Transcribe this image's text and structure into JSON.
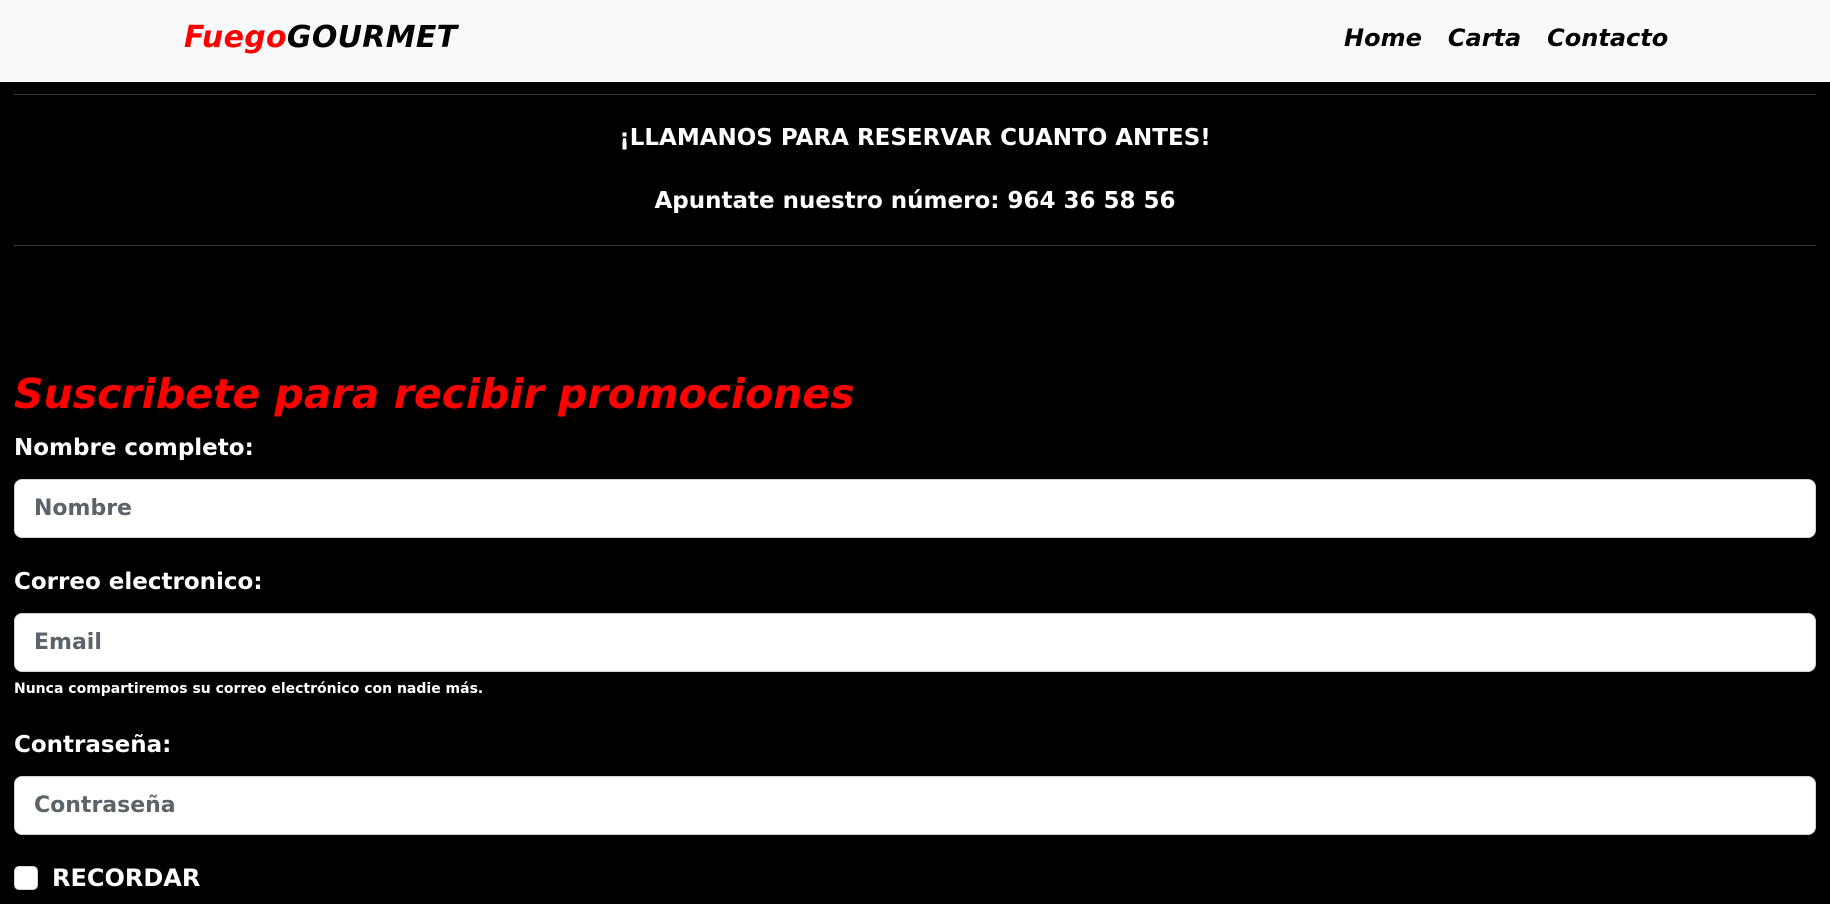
{
  "navbar": {
    "brand_part1": "Fuego",
    "brand_part2": "GOURMET",
    "links": [
      "Home",
      "Carta",
      "Contacto"
    ]
  },
  "promo": {
    "line1": "¡LLAMANOS PARA RESERVAR CUANTO ANTES!",
    "line2": "Apuntate nuestro número: 964 36 58 56"
  },
  "form": {
    "title": "Suscribete para recibir promociones",
    "name_label": "Nombre completo:",
    "name_placeholder": "Nombre",
    "name_value": "",
    "email_label": "Correo electronico:",
    "email_placeholder": "Email",
    "email_value": "",
    "email_help": "Nunca compartiremos su correo electrónico con nadie más.",
    "password_label": "Contraseña:",
    "password_placeholder": "Contraseña",
    "password_value": "",
    "remember_label": "RECORDAR",
    "remember_checked": false
  },
  "colors": {
    "accent_red": "#ff0000",
    "navbar_bg": "#f8f9fa",
    "page_bg": "#000000"
  }
}
